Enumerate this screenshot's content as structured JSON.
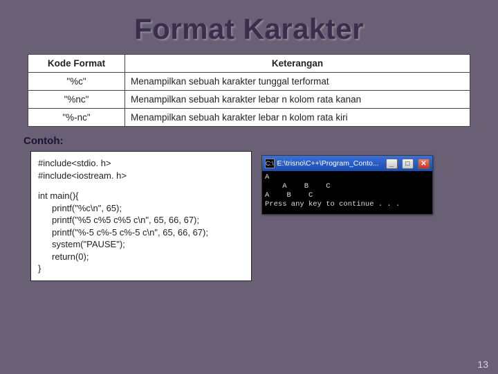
{
  "title": "Format Karakter",
  "table": {
    "headers": [
      "Kode Format",
      "Keterangan"
    ],
    "rows": [
      {
        "code": "\"%c\"",
        "desc": "Menampilkan sebuah karakter tunggal terformat"
      },
      {
        "code": "\"%nc\"",
        "desc": "Menampilkan sebuah karakter lebar n kolom rata kanan"
      },
      {
        "code": "\"%-nc\"",
        "desc": "Menampilkan sebuah karakter lebar n kolom rata kiri"
      }
    ]
  },
  "contoh_label": "Contoh:",
  "code": {
    "l1": "#include<stdio. h>",
    "l2": "#include<iostream. h>",
    "l3": "int main(){",
    "l4": "printf(\"%c\\n\", 65);",
    "l5": "printf(\"%5 c%5 c%5 c\\n\", 65, 66, 67);",
    "l6": "printf(\"%-5 c%-5 c%-5 c\\n\", 65, 66, 67);",
    "l7": "system(\"PAUSE\");",
    "l8": "return(0);",
    "l9": "}"
  },
  "console": {
    "title": "E:\\trisno\\C++\\Program_Conto...",
    "line1": "A",
    "line2": "    A    B    C",
    "line3": "A    B    C",
    "line4": "Press any key to continue . . ."
  },
  "winbtn": {
    "min": "_",
    "max": "□",
    "close": "✕"
  },
  "page_number": "13"
}
